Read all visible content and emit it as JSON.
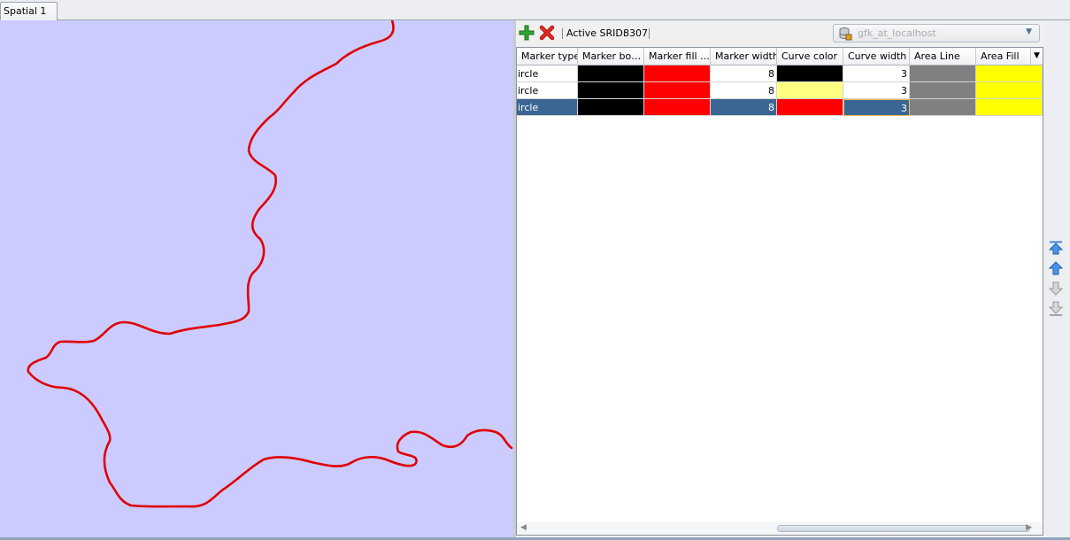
{
  "tabs": [
    {
      "label": "Spatial 1"
    }
  ],
  "toolbar": {
    "srid_label": "Active SRID:",
    "srid_value": "8307",
    "connection": "gfk_at_localhost"
  },
  "table": {
    "columns": [
      "Marker type",
      "Marker bo…",
      "Marker fill …",
      "Marker width",
      "Curve color",
      "Curve width",
      "Area Line",
      "Area Fill"
    ],
    "rows": [
      {
        "marker_type": "ircle",
        "marker_border": "#000000",
        "marker_fill": "#ff0000",
        "marker_width": "8",
        "curve_color": "#000000",
        "curve_width": "3",
        "area_line": "#808080",
        "area_fill": "#ffff00"
      },
      {
        "marker_type": "ircle",
        "marker_border": "#000000",
        "marker_fill": "#ff0000",
        "marker_width": "8",
        "curve_color": "#ffff80",
        "curve_width": "3",
        "area_line": "#808080",
        "area_fill": "#ffff00"
      },
      {
        "marker_type": "ircle",
        "marker_border": "#000000",
        "marker_fill": "#ff0000",
        "marker_width": "8",
        "curve_color": "#ff0000",
        "curve_width": "3",
        "area_line": "#808080",
        "area_fill": "#ffff00",
        "selected": true
      }
    ]
  },
  "map": {
    "background": "#cbcbff",
    "curve_color": "#e00000"
  },
  "icons": {
    "add": "plus-icon",
    "remove": "delete-icon",
    "database": "database-icon",
    "move_top": "move-top-icon",
    "move_up": "move-up-icon",
    "move_down": "move-down-icon",
    "move_bottom": "move-bottom-icon"
  }
}
